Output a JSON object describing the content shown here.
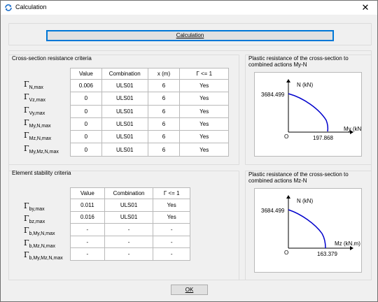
{
  "window": {
    "title": "Calculation",
    "close_glyph": "✕",
    "icon": "refresh-icon"
  },
  "calculation_button": "Calculation",
  "resistance": {
    "group_label": "Cross-section resistance criteria",
    "headers": [
      "Value",
      "Combination",
      "x (m)",
      "Γ <= 1"
    ],
    "rows": [
      {
        "symbol": "Γ",
        "sub": "N,max",
        "value": "0.006",
        "combination": "ULS01",
        "x": "6",
        "check": "Yes"
      },
      {
        "symbol": "Γ",
        "sub": "Vz,max",
        "value": "0",
        "combination": "ULS01",
        "x": "6",
        "check": "Yes"
      },
      {
        "symbol": "Γ",
        "sub": "Vy,max",
        "value": "0",
        "combination": "ULS01",
        "x": "6",
        "check": "Yes"
      },
      {
        "symbol": "Γ",
        "sub": "My,N,max",
        "value": "0",
        "combination": "ULS01",
        "x": "6",
        "check": "Yes"
      },
      {
        "symbol": "Γ",
        "sub": "Mz,N,max",
        "value": "0",
        "combination": "ULS01",
        "x": "6",
        "check": "Yes"
      },
      {
        "symbol": "Γ",
        "sub": "My,Mz,N,max",
        "value": "0",
        "combination": "ULS01",
        "x": "6",
        "check": "Yes"
      }
    ]
  },
  "stability": {
    "group_label": "Element stability criteria",
    "headers": [
      "Value",
      "Combination",
      "Γ <= 1"
    ],
    "rows": [
      {
        "symbol": "Γ",
        "sub": "by,max",
        "value": "0.011",
        "combination": "ULS01",
        "check": "Yes"
      },
      {
        "symbol": "Γ",
        "sub": "bz,max",
        "value": "0.016",
        "combination": "ULS01",
        "check": "Yes"
      },
      {
        "symbol": "Γ",
        "sub": "b,My,N,max",
        "value": "-",
        "combination": "-",
        "check": "-"
      },
      {
        "symbol": "Γ",
        "sub": "b,Mz,N,max",
        "value": "-",
        "combination": "-",
        "check": "-"
      },
      {
        "symbol": "Γ",
        "sub": "b,My,Mz,N,max",
        "value": "-",
        "combination": "-",
        "check": "-"
      }
    ]
  },
  "plot_my": {
    "title_line1": "Plastic resistance of the cross-section to",
    "title_line2": "combined actions My-N",
    "y_axis_label": "N (kN)",
    "x_axis_label": "My (kN.m)",
    "y_value": "3684.499",
    "x_value": "197.868",
    "origin": "O",
    "curve_color": "#0000cc"
  },
  "plot_mz": {
    "title_line1": "Plastic resistance of the cross-section to",
    "title_line2": "combined actions Mz-N",
    "y_axis_label": "N (kN)",
    "x_axis_label": "Mz (kN.m)",
    "y_value": "3684.499",
    "x_value": "163.379",
    "origin": "O",
    "curve_color": "#0000cc"
  },
  "ok_button": "OK"
}
